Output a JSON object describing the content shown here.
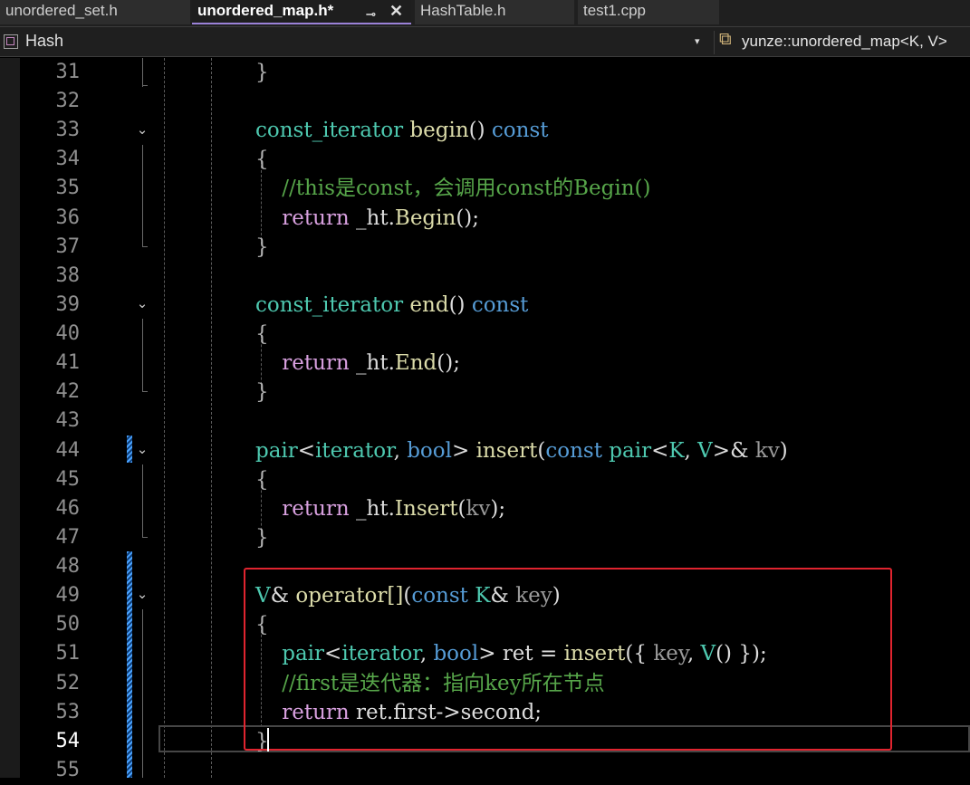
{
  "tabs": [
    {
      "label": "unordered_set.h",
      "active": false
    },
    {
      "label": "unordered_map.h*",
      "active": true,
      "pin_icon": "pin-icon",
      "close_icon": "close-icon",
      "close_glyph": "✕"
    },
    {
      "label": "HashTable.h",
      "active": false
    },
    {
      "label": "test1.cpp",
      "active": false
    }
  ],
  "navbar": {
    "project": "Hash",
    "dropdown_glyph": "▾",
    "scope_icon": "class-scope-icon",
    "scope": "yunze::unordered_map<K, V>"
  },
  "colors": {
    "type": "#4ec9b0",
    "function": "#dcdcaa",
    "keyword": "#569cd6",
    "control": "#d8a0df",
    "comment": "#57a64a",
    "highlight_box": "#e0242f",
    "active_tab_accent": "#9b82d8"
  },
  "editor": {
    "current_line": 54,
    "lines": [
      {
        "n": "31",
        "tokens": [
          {
            "t": "}",
            "c": "brace"
          }
        ]
      },
      {
        "n": "32",
        "tokens": []
      },
      {
        "n": "33",
        "tokens": [
          {
            "t": "const_iterator",
            "c": "type"
          },
          {
            "t": " ",
            "c": "punct"
          },
          {
            "t": "begin",
            "c": "func"
          },
          {
            "t": "() ",
            "c": "punct"
          },
          {
            "t": "const",
            "c": "kw"
          }
        ]
      },
      {
        "n": "34",
        "tokens": [
          {
            "t": "{",
            "c": "brace"
          }
        ]
      },
      {
        "n": "35",
        "tokens": [
          {
            "t": "    //this是const，会调用const的Begin()",
            "c": "cm"
          }
        ]
      },
      {
        "n": "36",
        "tokens": [
          {
            "t": "    ",
            "c": "punct"
          },
          {
            "t": "return",
            "c": "ctl"
          },
          {
            "t": " _ht.",
            "c": "id"
          },
          {
            "t": "Begin",
            "c": "func"
          },
          {
            "t": "();",
            "c": "punct"
          }
        ]
      },
      {
        "n": "37",
        "tokens": [
          {
            "t": "}",
            "c": "brace"
          }
        ]
      },
      {
        "n": "38",
        "tokens": []
      },
      {
        "n": "39",
        "tokens": [
          {
            "t": "const_iterator",
            "c": "type"
          },
          {
            "t": " ",
            "c": "punct"
          },
          {
            "t": "end",
            "c": "func"
          },
          {
            "t": "() ",
            "c": "punct"
          },
          {
            "t": "const",
            "c": "kw"
          }
        ]
      },
      {
        "n": "40",
        "tokens": [
          {
            "t": "{",
            "c": "brace"
          }
        ]
      },
      {
        "n": "41",
        "tokens": [
          {
            "t": "    ",
            "c": "punct"
          },
          {
            "t": "return",
            "c": "ctl"
          },
          {
            "t": " _ht.",
            "c": "id"
          },
          {
            "t": "End",
            "c": "func"
          },
          {
            "t": "();",
            "c": "punct"
          }
        ]
      },
      {
        "n": "42",
        "tokens": [
          {
            "t": "}",
            "c": "brace"
          }
        ]
      },
      {
        "n": "43",
        "tokens": []
      },
      {
        "n": "44",
        "tokens": [
          {
            "t": "pair",
            "c": "type"
          },
          {
            "t": "<",
            "c": "punct"
          },
          {
            "t": "iterator",
            "c": "type"
          },
          {
            "t": ", ",
            "c": "punct"
          },
          {
            "t": "bool",
            "c": "kw"
          },
          {
            "t": "> ",
            "c": "punct"
          },
          {
            "t": "insert",
            "c": "func"
          },
          {
            "t": "(",
            "c": "punct"
          },
          {
            "t": "const",
            "c": "kw"
          },
          {
            "t": " ",
            "c": "punct"
          },
          {
            "t": "pair",
            "c": "type"
          },
          {
            "t": "<",
            "c": "punct"
          },
          {
            "t": "K",
            "c": "type"
          },
          {
            "t": ", ",
            "c": "punct"
          },
          {
            "t": "V",
            "c": "type"
          },
          {
            "t": ">& ",
            "c": "punct"
          },
          {
            "t": "kv",
            "c": "param"
          },
          {
            "t": ")",
            "c": "punct"
          }
        ]
      },
      {
        "n": "45",
        "tokens": [
          {
            "t": "{",
            "c": "brace"
          }
        ]
      },
      {
        "n": "46",
        "tokens": [
          {
            "t": "    ",
            "c": "punct"
          },
          {
            "t": "return",
            "c": "ctl"
          },
          {
            "t": " _ht.",
            "c": "id"
          },
          {
            "t": "Insert",
            "c": "func"
          },
          {
            "t": "(",
            "c": "punct"
          },
          {
            "t": "kv",
            "c": "param"
          },
          {
            "t": ");",
            "c": "punct"
          }
        ]
      },
      {
        "n": "47",
        "tokens": [
          {
            "t": "}",
            "c": "brace"
          }
        ]
      },
      {
        "n": "48",
        "tokens": []
      },
      {
        "n": "49",
        "tokens": [
          {
            "t": "V",
            "c": "type"
          },
          {
            "t": "& ",
            "c": "punct"
          },
          {
            "t": "operator[]",
            "c": "func"
          },
          {
            "t": "(",
            "c": "punct"
          },
          {
            "t": "const",
            "c": "kw"
          },
          {
            "t": " ",
            "c": "punct"
          },
          {
            "t": "K",
            "c": "type"
          },
          {
            "t": "& ",
            "c": "punct"
          },
          {
            "t": "key",
            "c": "param"
          },
          {
            "t": ")",
            "c": "punct"
          }
        ]
      },
      {
        "n": "50",
        "tokens": [
          {
            "t": "{",
            "c": "brace"
          }
        ]
      },
      {
        "n": "51",
        "tokens": [
          {
            "t": "    ",
            "c": "punct"
          },
          {
            "t": "pair",
            "c": "type"
          },
          {
            "t": "<",
            "c": "punct"
          },
          {
            "t": "iterator",
            "c": "type"
          },
          {
            "t": ", ",
            "c": "punct"
          },
          {
            "t": "bool",
            "c": "kw"
          },
          {
            "t": "> ",
            "c": "punct"
          },
          {
            "t": "ret",
            "c": "id"
          },
          {
            "t": " = ",
            "c": "punct"
          },
          {
            "t": "insert",
            "c": "func"
          },
          {
            "t": "({ ",
            "c": "punct"
          },
          {
            "t": "key",
            "c": "param"
          },
          {
            "t": ", ",
            "c": "punct"
          },
          {
            "t": "V",
            "c": "type"
          },
          {
            "t": "() });",
            "c": "punct"
          }
        ]
      },
      {
        "n": "52",
        "tokens": [
          {
            "t": "    //first是迭代器：指向key所在节点",
            "c": "cm"
          }
        ]
      },
      {
        "n": "53",
        "tokens": [
          {
            "t": "    ",
            "c": "punct"
          },
          {
            "t": "return",
            "c": "ctl"
          },
          {
            "t": " ret.first->second;",
            "c": "id"
          }
        ]
      },
      {
        "n": "54",
        "tokens": [
          {
            "t": "}",
            "c": "brace"
          }
        ]
      },
      {
        "n": "55",
        "tokens": []
      }
    ]
  }
}
